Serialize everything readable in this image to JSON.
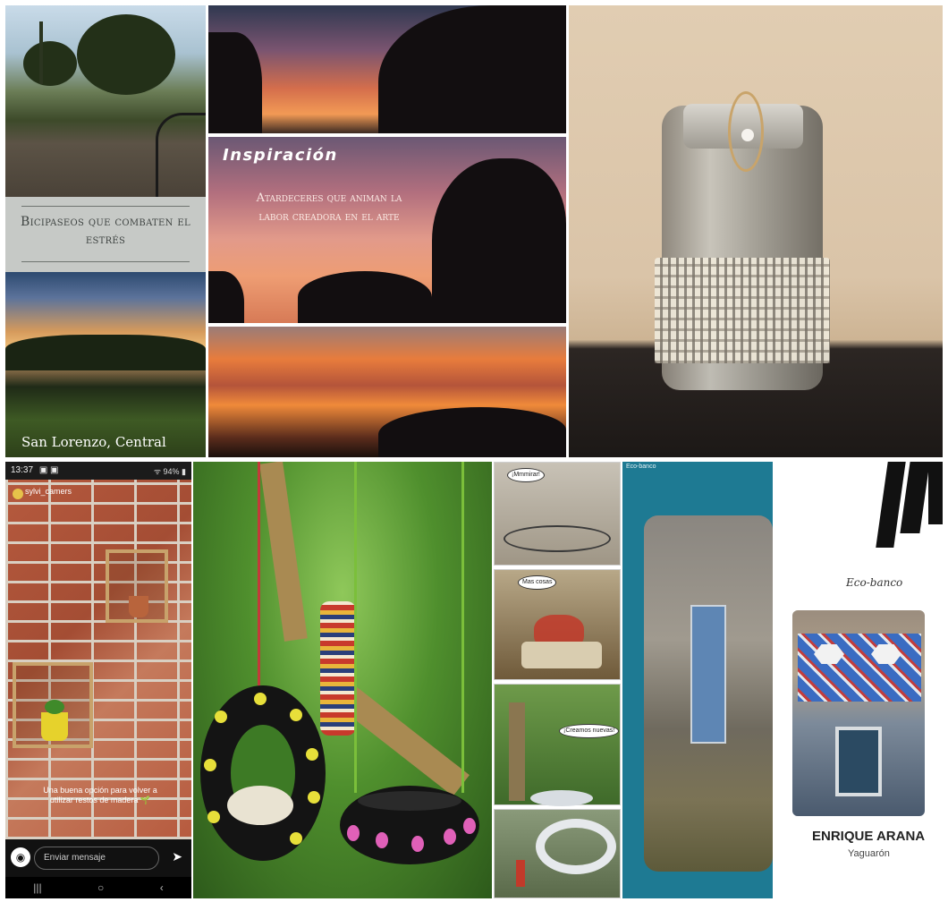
{
  "collage": {
    "bike_panel": {
      "title": "Bicipaseos que combaten el estrés",
      "caption": "San Lorenzo, Central"
    },
    "sunset_panel": {
      "heading": "Inspiración",
      "text": "Atardeceres que animan la labor creadora en el arte"
    },
    "phone_panel": {
      "clock": "13:37",
      "status_icons": "▣ ▣",
      "signal": "ᯤ 94% ▮",
      "username": "sylvi_camers",
      "story_text": "Una buena opción para volver a utilizar restos de madera 🌱",
      "message_placeholder": "Enviar mensaje",
      "nav_recent": "|||",
      "nav_home": "○",
      "nav_back": "‹"
    },
    "comic_panel": {
      "bubble_1": "¡Mmmirar!",
      "bubble_2": "Mas cosas",
      "bubble_3": "¡Creamos nuevas!"
    },
    "eco_panel": {
      "corner_label": "Eco-banco",
      "subtitle": "Eco-banco",
      "author": "ENRIQUE ARANA",
      "place": "Yaguarón"
    }
  },
  "colors": {
    "eco_teal": "#1e7a93",
    "sunset_orange": "#e87c3c",
    "brick": "#b65a3e"
  }
}
